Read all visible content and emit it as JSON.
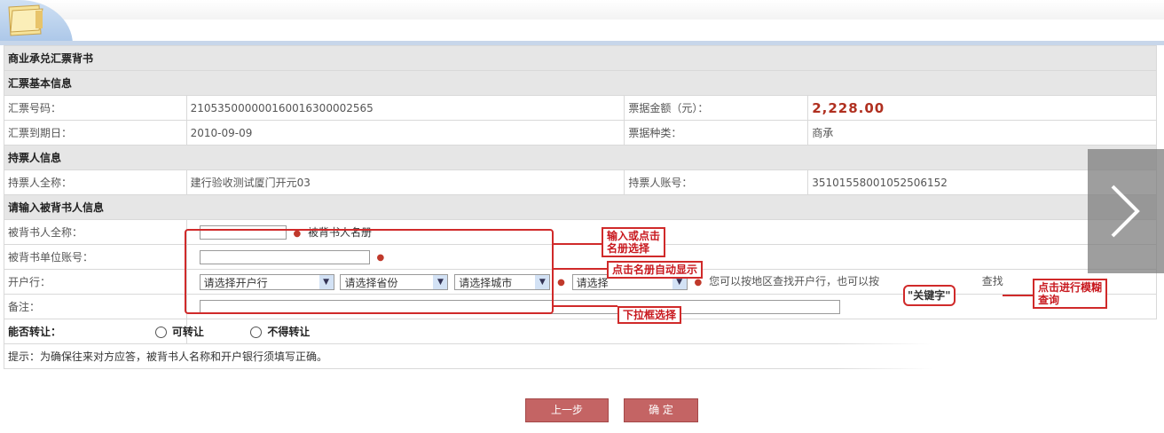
{
  "form": {
    "title": "商业承兑汇票背书",
    "section_basic": "汇票基本信息",
    "label_bill_no": "汇票号码：",
    "value_bill_no": "210535000000160016300002565",
    "label_amount": "票据金额（元）：",
    "value_amount": "2,228.00",
    "label_due_date": "汇票到期日：",
    "value_due_date": "2010-09-09",
    "label_bill_type": "票据种类：",
    "value_bill_type": "商承",
    "section_holder": "持票人信息",
    "label_holder_name": "持票人全称：",
    "value_holder_name": "建行验收测试厦门开元03",
    "label_holder_account": "持票人账号：",
    "value_holder_account": "35101558001052506152",
    "section_endorsee": "请输入被背书人信息",
    "label_endorsee_name": "被背书人全称：",
    "endorsee_name_hint": "被背书人名册",
    "label_endorsee_account": "被背书单位账号：",
    "label_bank": "开户行：",
    "bank_select": "请选择开户行",
    "province_select": "请选择省份",
    "city_select": "请选择城市",
    "category_select": "请选择",
    "bank_search_text": "您可以按地区查找开户行，也可以按",
    "keyword_label": "\"关键字\"",
    "search_suffix": "查找",
    "label_remark": "备注：",
    "label_transfer": "能否转让：",
    "option_transferable": "可转让",
    "option_not_transferable": "不得转让",
    "hint": "提示：为确保往来对方应答，被背书人名称和开户银行须填写正确。",
    "btn_prev": "上一步",
    "btn_confirm": "确 定"
  },
  "annotations": {
    "input_or_select": "输入或点击\n名册选择",
    "auto_fill": "点击名册自动显示",
    "dropdown_select": "下拉框选择",
    "fuzzy_search": "点击进行模糊\n查询"
  },
  "icons": {
    "folder": "folder-icon",
    "next": "chevron-right-icon",
    "dropdown": "chevron-down-icon"
  },
  "colors": {
    "accent_red": "#d02a2a",
    "button": "#c46464",
    "header_bg": "#e6e6e6",
    "amount": "#b03020"
  }
}
